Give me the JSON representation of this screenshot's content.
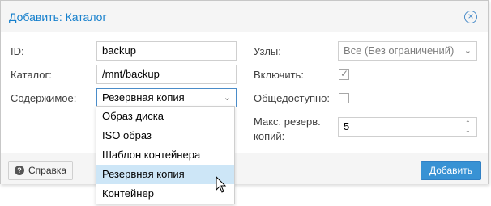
{
  "dialog": {
    "title": "Добавить: Каталог",
    "close_icon": "close-circle-icon"
  },
  "form": {
    "id_label": "ID:",
    "id_value": "backup",
    "directory_label": "Каталог:",
    "directory_value": "/mnt/backup",
    "content_label": "Содержимое:",
    "content_value": "Резервная копия",
    "nodes_label": "Узлы:",
    "nodes_value": "Все (Без ограничений)",
    "enable_label": "Включить:",
    "enable_checked": true,
    "shared_label": "Общедоступно:",
    "shared_checked": false,
    "max_backups_label_line1": "Макс. резерв.",
    "max_backups_label_line2": "копий:",
    "max_backups_value": "5"
  },
  "content_dropdown": {
    "options": [
      "Образ диска",
      "ISO образ",
      "Шаблон контейнера",
      "Резервная копия",
      "Контейнер"
    ],
    "selected_index": 3
  },
  "footer": {
    "help_label": "Справка",
    "add_label": "Добавить"
  },
  "colors": {
    "accent": "#157fcc",
    "primary_button": "#3892d4",
    "selected_option": "#cde6f7"
  }
}
